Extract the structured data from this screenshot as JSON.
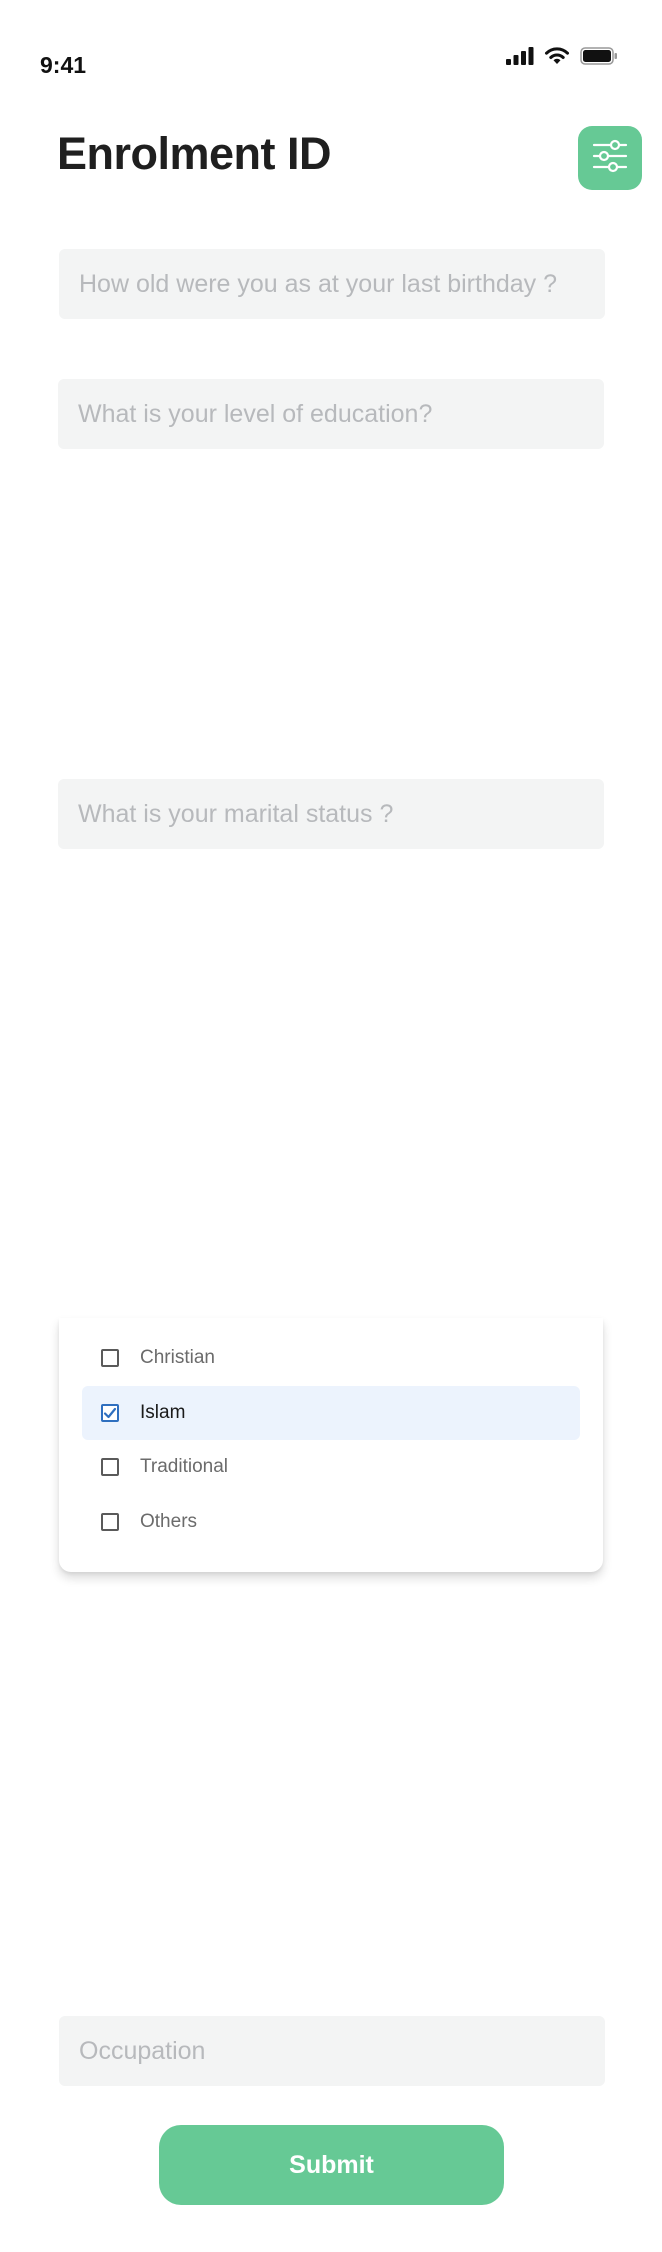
{
  "status_bar": {
    "time": "9:41",
    "icons": [
      "signal-icon",
      "wifi-icon",
      "battery-icon"
    ]
  },
  "header": {
    "title": "Enrolment ID",
    "filter_icon": "sliders-icon"
  },
  "form": {
    "age": {
      "placeholder": "How old were you as at your last birthday ?",
      "value": ""
    },
    "education": {
      "placeholder": "What is your level of education?",
      "value": ""
    },
    "marital_status": {
      "placeholder": "What is your marital status ?",
      "value": ""
    },
    "religion_options": [
      {
        "label": "Christian",
        "checked": false
      },
      {
        "label": "Islam",
        "checked": true
      },
      {
        "label": "Traditional",
        "checked": false
      },
      {
        "label": "Others",
        "checked": false
      }
    ],
    "occupation": {
      "placeholder": "Occupation",
      "value": ""
    },
    "submit_label": "Submit"
  },
  "colors": {
    "accent": "#66c995",
    "field_bg": "#f3f4f4",
    "selected_bg": "#ecf3fd",
    "checkbox_checked": "#2f6fbf"
  }
}
